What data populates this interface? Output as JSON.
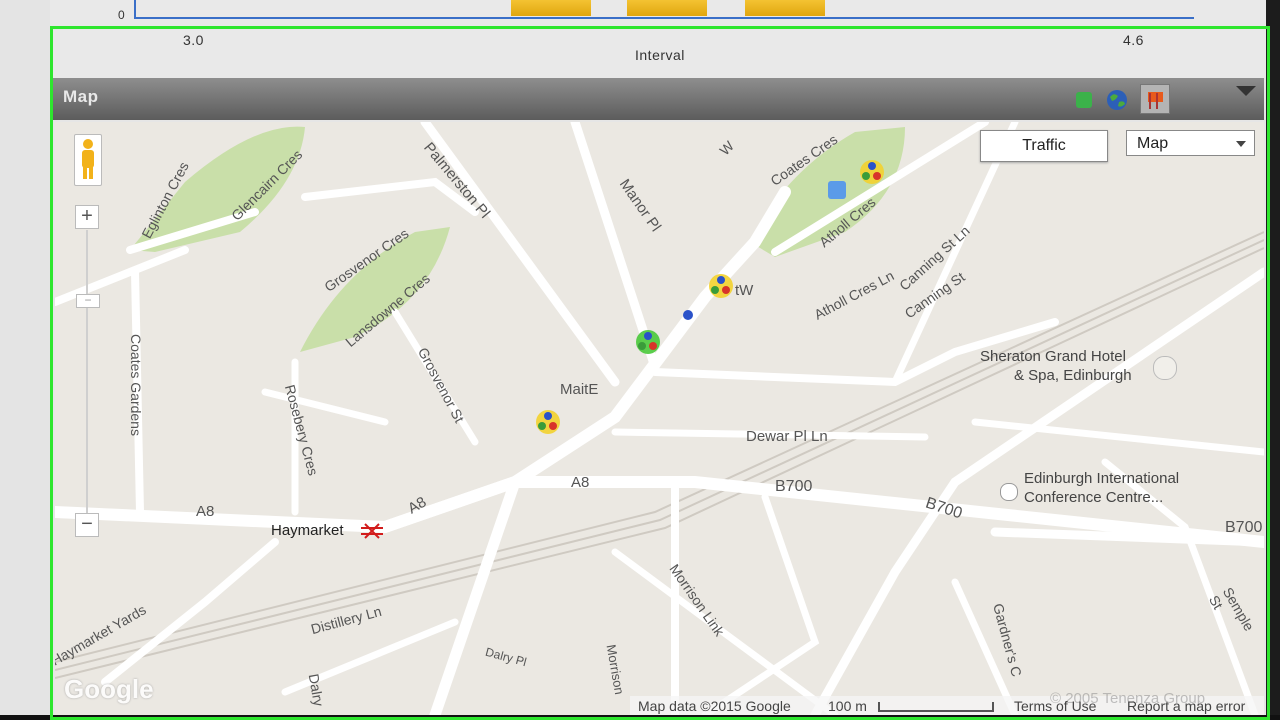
{
  "chart": {
    "y_tick": "0",
    "x_ticks": [
      "3.0",
      "4.6"
    ],
    "x_label": "Interval"
  },
  "panel": {
    "title": "Map",
    "icons": [
      "green-square-icon",
      "globe-icon",
      "pin-icon"
    ],
    "collapse_icon": "triangle-down-icon"
  },
  "map": {
    "traffic_button": "Traffic",
    "map_type": "Map",
    "labels": {
      "eglinton": "Eglinton Cres",
      "glencairn": "Glencairn Cres",
      "palmerston": "Palmerston Pl",
      "manor": "Manor Pl",
      "coates_cres": "Coates Cres",
      "atholl_cres": "Atholl Cres",
      "atholl_cres_ln": "Atholl Cres Ln",
      "canning_st_ln": "Canning St Ln",
      "canning_st": "Canning St",
      "grosvenor_cres": "Grosvenor Cres",
      "lansdowne": "Lansdowne Cres",
      "grosvenor_st": "Grosvenor St",
      "coates_gardens": "Coates Gardens",
      "rosebery": "Rosebery Cres",
      "sheraton": "Sheraton Grand Hotel",
      "sheraton2": "& Spa, Edinburgh",
      "dewar": "Dewar Pl Ln",
      "a8_left": "A8",
      "a8_diag": "A8",
      "a8_mid": "A8",
      "b700_a": "B700",
      "b700_b": "B700",
      "b700_c": "B700",
      "eicc": "Edinburgh International",
      "eicc2": "Conference Centre...",
      "haymarket": "Haymarket",
      "haymarket_yards": "Haymarket Yards",
      "distillery": "Distillery Ln",
      "morrison_link": "Morrison Link",
      "dalry_pl": "Dalry Pl",
      "morrison": "Morrison",
      "dalry": "Dalry",
      "gardners": "Gardner's C",
      "semple": "Semple St",
      "marker_tw": "tW",
      "marker_maite": "MaitE",
      "w_partial": "W"
    },
    "footer": {
      "map_data": "Map data ©2015 Google",
      "scale": "100 m",
      "terms": "Terms of Use",
      "report": "Report a map error",
      "copyright": "© 2005 Tenenza Group"
    },
    "logo": "Google",
    "zoom_in": "+",
    "zoom_out": "−",
    "zoom_slider_mid": "−"
  },
  "colors": {
    "frame": "#2ee62e",
    "bar": "#e8b01c",
    "road": "#ffffff",
    "park": "#c9dfa9",
    "land": "#ebe8e2"
  }
}
